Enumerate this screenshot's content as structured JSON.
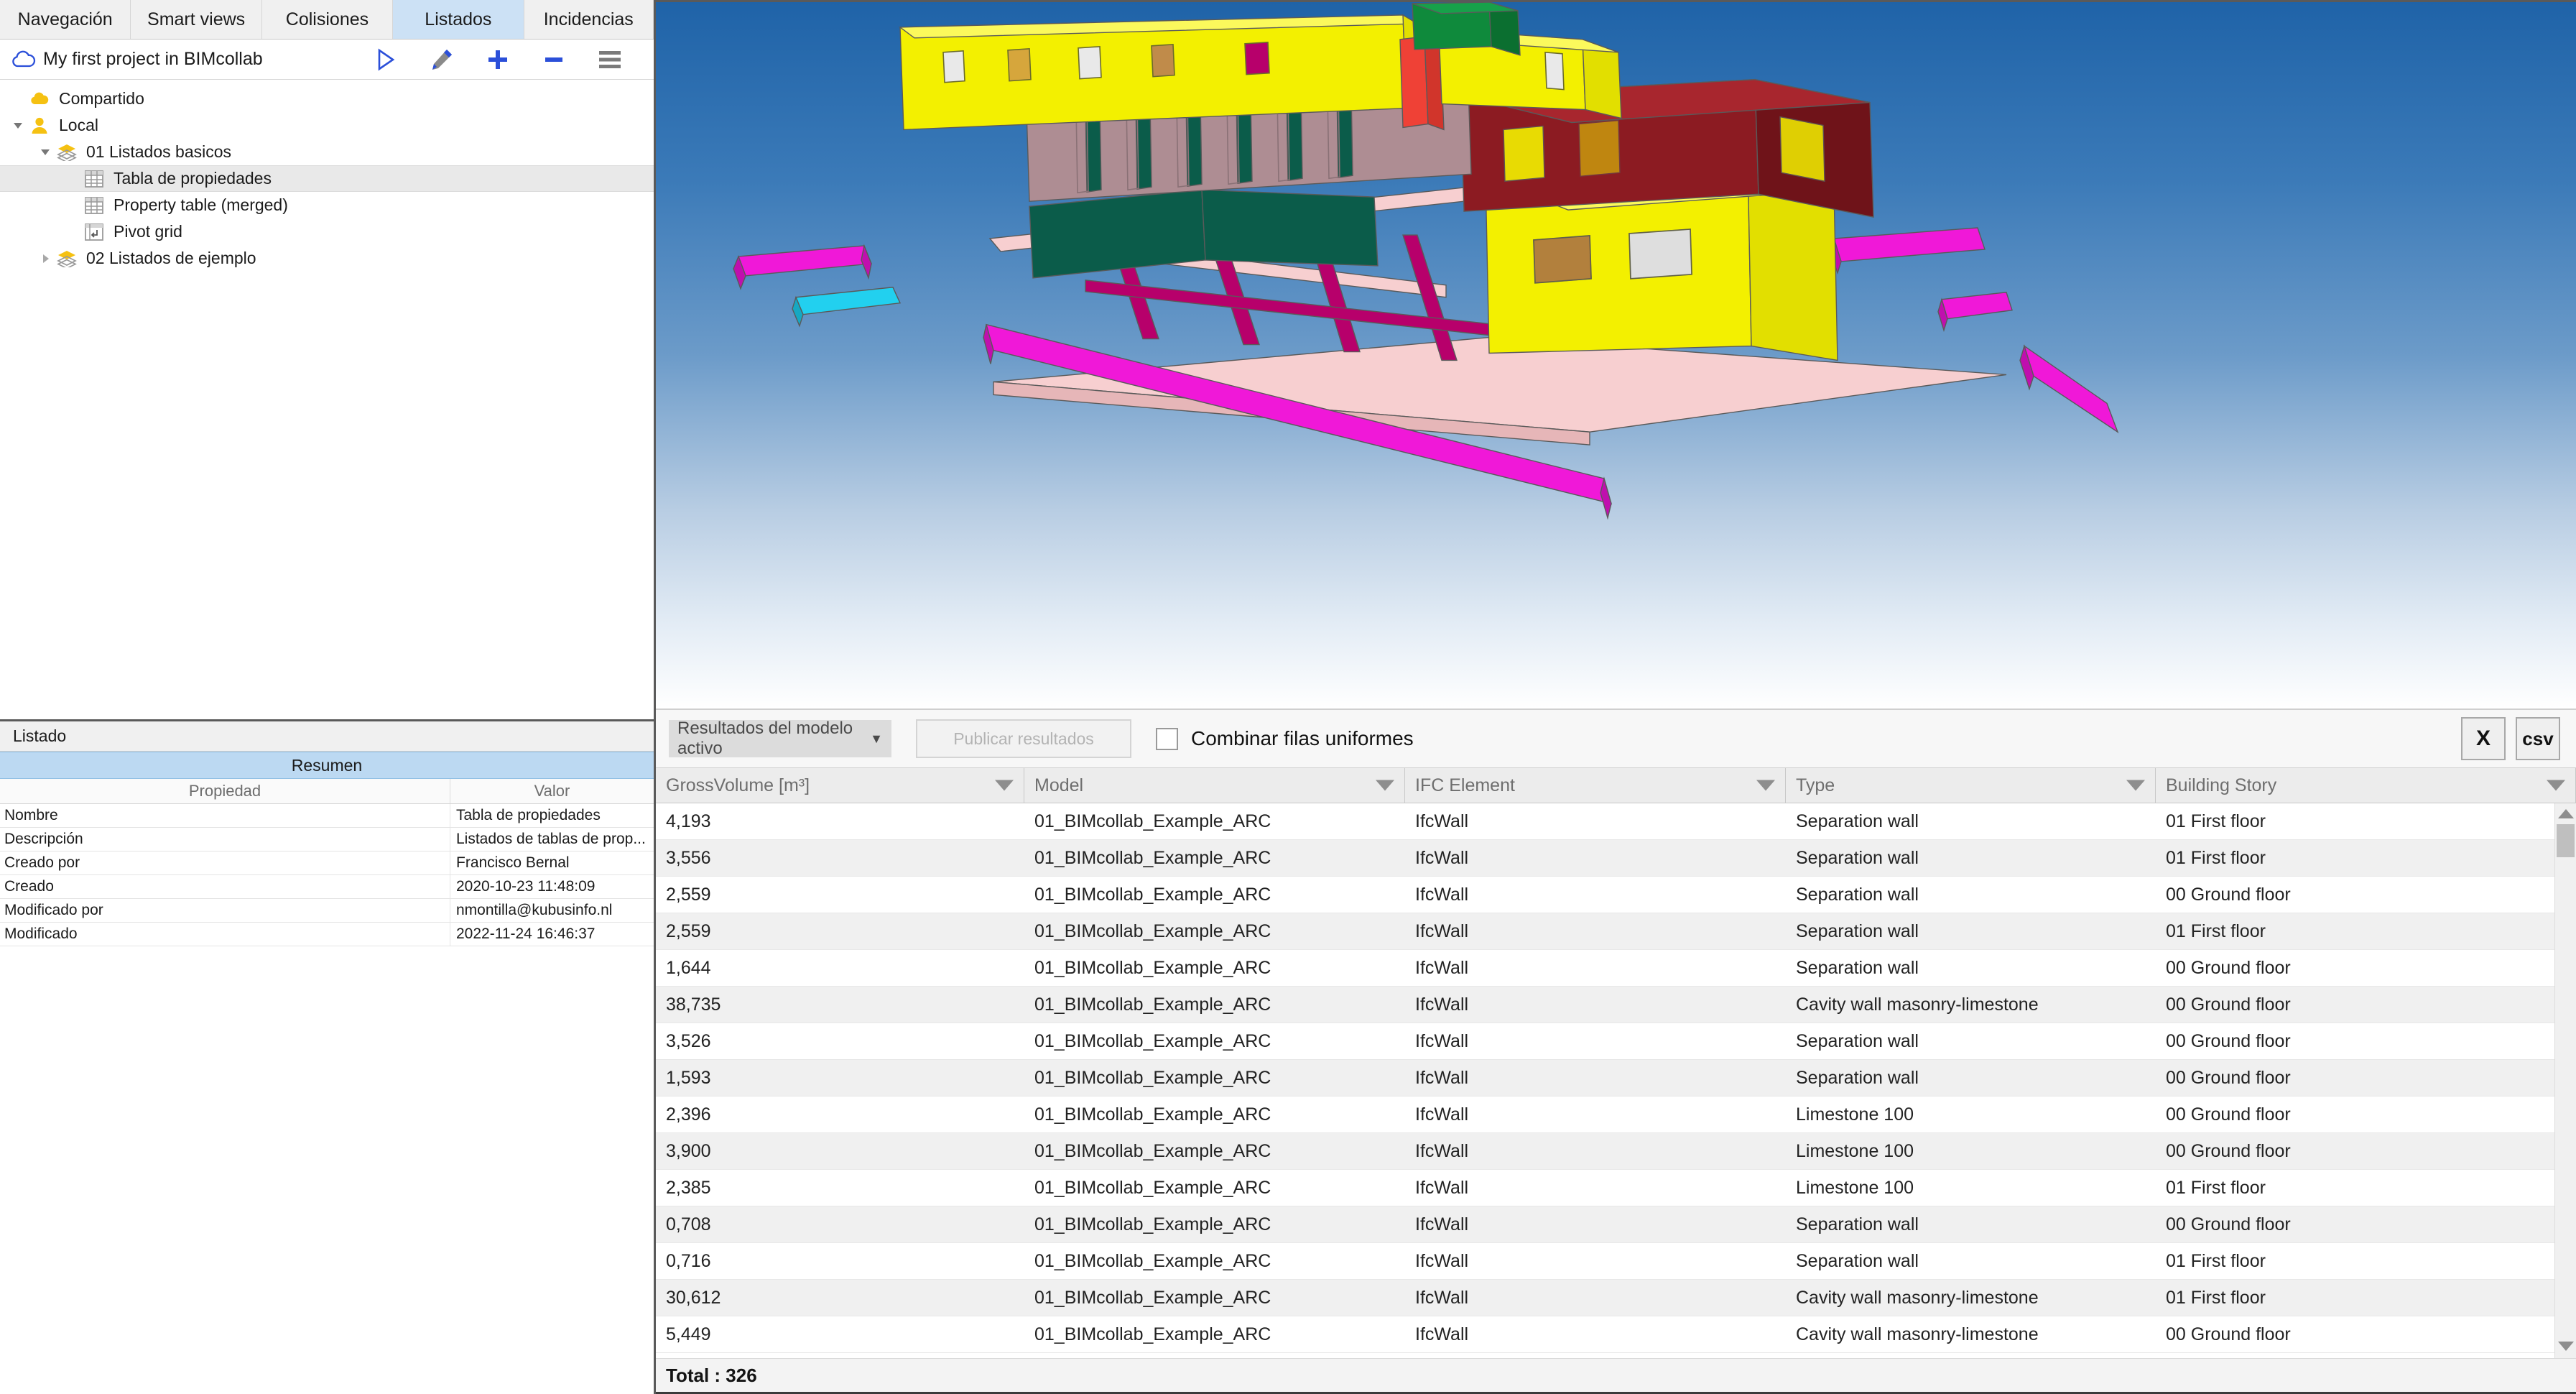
{
  "tabs": [
    {
      "label": "Navegación",
      "active": false
    },
    {
      "label": "Smart views",
      "active": false
    },
    {
      "label": "Colisiones",
      "active": false
    },
    {
      "label": "Listados",
      "active": true
    },
    {
      "label": "Incidencias",
      "active": false
    }
  ],
  "project": {
    "name": "My first project in BIMcollab",
    "icon": "cloud-icon",
    "actions": [
      {
        "name": "run-icon",
        "glyph": "play"
      },
      {
        "name": "edit-pencil-icon",
        "glyph": "pencil"
      },
      {
        "name": "add-icon",
        "glyph": "plus"
      },
      {
        "name": "remove-icon",
        "glyph": "minus"
      },
      {
        "name": "menu-icon",
        "glyph": "hamburger"
      }
    ]
  },
  "tree": [
    {
      "label": "Compartido",
      "icon": "cloud-folder-icon",
      "indent": 1,
      "twisty": "none",
      "selected": false
    },
    {
      "label": "Local",
      "icon": "user-icon",
      "indent": 1,
      "twisty": "open",
      "selected": false
    },
    {
      "label": "01 Listados basicos",
      "icon": "layers-icon",
      "indent": 2,
      "twisty": "open",
      "selected": false
    },
    {
      "label": "Tabla de propiedades",
      "icon": "table-icon",
      "indent": 3,
      "twisty": "none",
      "selected": true
    },
    {
      "label": "Property table (merged)",
      "icon": "table-icon",
      "indent": 3,
      "twisty": "none",
      "selected": false
    },
    {
      "label": "Pivot grid",
      "icon": "pivot-grid-icon",
      "indent": 3,
      "twisty": "none",
      "selected": false
    },
    {
      "label": "02 Listados de ejemplo",
      "icon": "layers-icon",
      "indent": 2,
      "twisty": "closed",
      "selected": false
    }
  ],
  "listado": {
    "panel_title": "Listado",
    "summary_title": "Resumen",
    "col_property": "Propiedad",
    "col_value": "Valor",
    "rows": [
      {
        "property": "Nombre",
        "value": "Tabla de propiedades"
      },
      {
        "property": "Descripción",
        "value": "Listados de tablas de prop..."
      },
      {
        "property": "Creado por",
        "value": "Francisco Bernal"
      },
      {
        "property": "Creado",
        "value": "2020-10-23 11:48:09"
      },
      {
        "property": "Modificado por",
        "value": "nmontilla@kubusinfo.nl"
      },
      {
        "property": "Modificado",
        "value": "2022-11-24 16:46:37"
      }
    ]
  },
  "results_toolbar": {
    "scope_select": "Resultados del modelo activo",
    "publish_button": "Publicar resultados",
    "combine_checkbox_label": "Combinar filas uniformes",
    "combine_checked": false,
    "excel_button": "X",
    "csv_button": "csv"
  },
  "results_table": {
    "columns": [
      "GrossVolume [m³]",
      "Model",
      "IFC Element",
      "Type",
      "Building Story"
    ],
    "rows": [
      [
        "4,193",
        "01_BIMcollab_Example_ARC",
        "IfcWall",
        "Separation wall",
        "01 First floor"
      ],
      [
        "3,556",
        "01_BIMcollab_Example_ARC",
        "IfcWall",
        "Separation wall",
        "01 First floor"
      ],
      [
        "2,559",
        "01_BIMcollab_Example_ARC",
        "IfcWall",
        "Separation wall",
        "00 Ground floor"
      ],
      [
        "2,559",
        "01_BIMcollab_Example_ARC",
        "IfcWall",
        "Separation wall",
        "01 First floor"
      ],
      [
        "1,644",
        "01_BIMcollab_Example_ARC",
        "IfcWall",
        "Separation wall",
        "00 Ground floor"
      ],
      [
        "38,735",
        "01_BIMcollab_Example_ARC",
        "IfcWall",
        "Cavity wall masonry-limestone",
        "00 Ground floor"
      ],
      [
        "3,526",
        "01_BIMcollab_Example_ARC",
        "IfcWall",
        "Separation wall",
        "00 Ground floor"
      ],
      [
        "1,593",
        "01_BIMcollab_Example_ARC",
        "IfcWall",
        "Separation wall",
        "00 Ground floor"
      ],
      [
        "2,396",
        "01_BIMcollab_Example_ARC",
        "IfcWall",
        "Limestone 100",
        "00 Ground floor"
      ],
      [
        "3,900",
        "01_BIMcollab_Example_ARC",
        "IfcWall",
        "Limestone 100",
        "00 Ground floor"
      ],
      [
        "2,385",
        "01_BIMcollab_Example_ARC",
        "IfcWall",
        "Limestone 100",
        "01 First floor"
      ],
      [
        "0,708",
        "01_BIMcollab_Example_ARC",
        "IfcWall",
        "Separation wall",
        "00 Ground floor"
      ],
      [
        "0,716",
        "01_BIMcollab_Example_ARC",
        "IfcWall",
        "Separation wall",
        "01 First floor"
      ],
      [
        "30,612",
        "01_BIMcollab_Example_ARC",
        "IfcWall",
        "Cavity wall masonry-limestone",
        "01 First floor"
      ],
      [
        "5,449",
        "01_BIMcollab_Example_ARC",
        "IfcWall",
        "Cavity wall masonry-limestone",
        "00 Ground floor"
      ]
    ],
    "total_label": "Total : 326"
  },
  "viewport": {
    "name": "3d-model-viewport",
    "sky_top": "#1f63a8",
    "sky_bottom": "#ffffff",
    "model_colors": {
      "yellow": "#f3f000",
      "mauve": "#ae8d93",
      "dark_red": "#8c1b22",
      "green": "#0f8a3c",
      "red_accent": "#ef4136",
      "teal": "#0b5c4a",
      "magenta": "#f018d8",
      "pink_pale": "#f7cfd0",
      "cyan": "#22d0ef",
      "crimson": "#b7006b"
    }
  }
}
